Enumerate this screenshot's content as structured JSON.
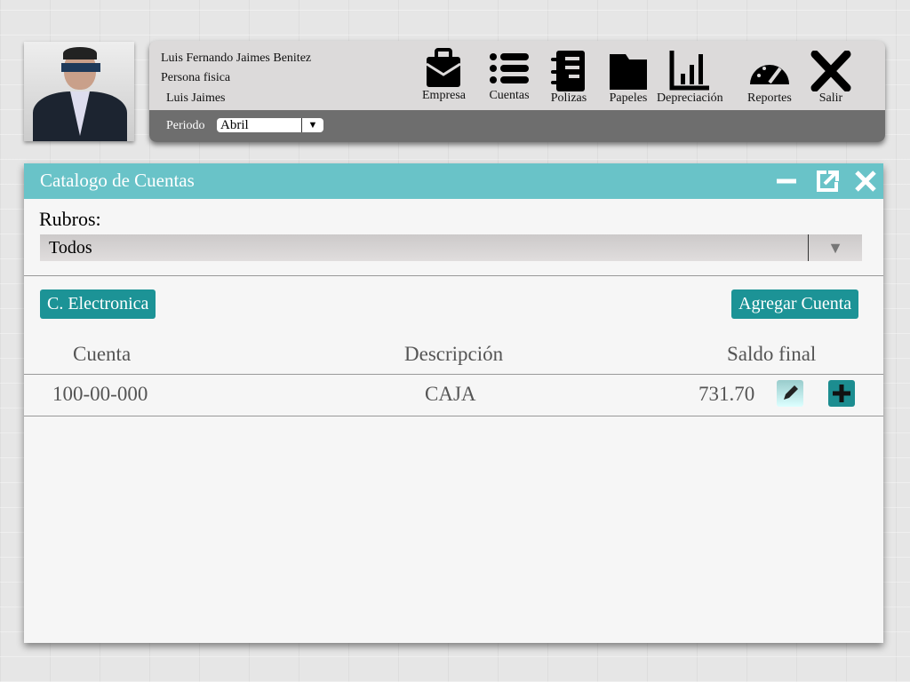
{
  "user": {
    "name": "Luis Fernando Jaimes Benitez",
    "type": "Persona fisica",
    "short": "Luis Jaimes"
  },
  "nav": [
    {
      "label": "Empresa",
      "icon": "briefcase-icon"
    },
    {
      "label": "Cuentas",
      "icon": "list-icon"
    },
    {
      "label": "Polizas",
      "icon": "notebook-icon"
    },
    {
      "label": "Papeles",
      "icon": "folder-icon"
    },
    {
      "label": "Depreciación",
      "icon": "bar-chart-icon"
    },
    {
      "label": "Reportes",
      "icon": "gauge-icon"
    },
    {
      "label": "Salir",
      "icon": "close-icon"
    }
  ],
  "periodo": {
    "label": "Periodo",
    "value": "Abril"
  },
  "window": {
    "title": "Catalogo de Cuentas",
    "rubros_label": "Rubros:",
    "rubros_value": "Todos",
    "btn_electronica": "C. Electronica",
    "btn_agregar": "Agregar Cuenta",
    "columns": [
      "Cuenta",
      "Descripción",
      "Saldo final"
    ],
    "rows": [
      {
        "cuenta": "100-00-000",
        "descripcion": "CAJA",
        "saldo": "731.70"
      }
    ]
  }
}
